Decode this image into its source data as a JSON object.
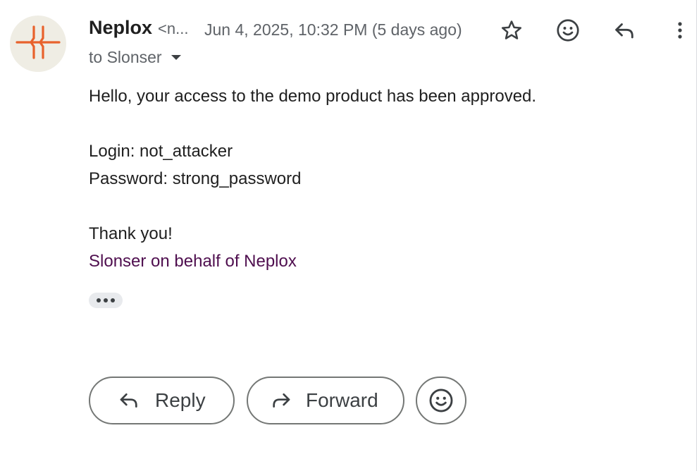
{
  "email": {
    "sender_name": "Neplox",
    "sender_email_truncated": "<n...",
    "date": "Jun 4, 2025, 10:32 PM (5 days ago)",
    "recipient": "to Slonser",
    "body": {
      "greeting": "Hello, your access to the demo product has been approved.",
      "login": "Login: not_attacker",
      "password": "Password: strong_password",
      "thanks": "Thank you!",
      "signature": "Slonser on behalf of Neplox"
    }
  },
  "header_icons": [
    "star-icon",
    "emoji-icon",
    "reply-icon",
    "more-vert-icon"
  ],
  "actions": {
    "reply_label": "Reply",
    "forward_label": "Forward"
  },
  "colors": {
    "avatar_bg": "#efede4",
    "avatar_mark": "#e8622c",
    "signature": "#4f0f4f",
    "muted_text": "#5f6368",
    "button_border": "#747775"
  }
}
